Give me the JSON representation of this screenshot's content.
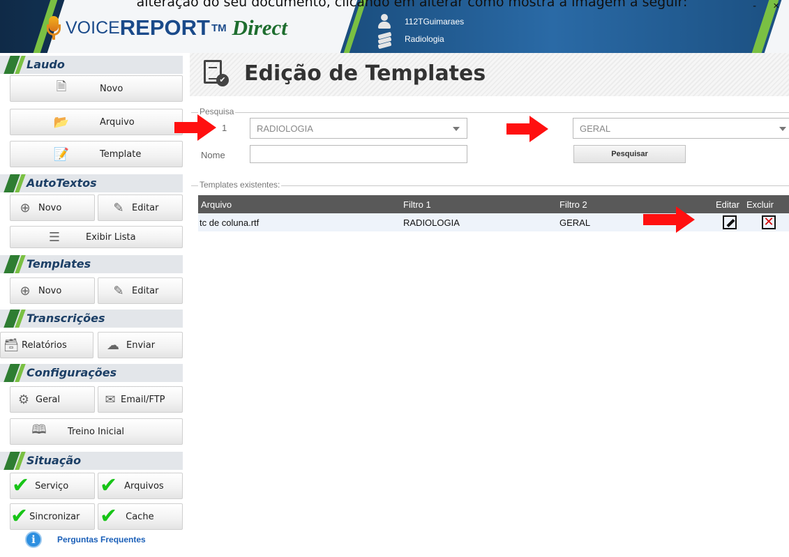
{
  "doc_caption": "alteração do seu documento, clicando em alterar como mostra a imagem a seguir:",
  "header": {
    "logo_voice": "VOICE",
    "logo_report": "REPORT",
    "logo_tm": "TM",
    "logo_direct": "Direct",
    "user_name": "112TGuimaraes",
    "user_department": "Radiologia",
    "window_controls": "- ×"
  },
  "sidebar": {
    "laudo": {
      "header": "Laudo",
      "novo": "Novo",
      "arquivo": "Arquivo",
      "template": "Template"
    },
    "autotextos": {
      "header": "AutoTextos",
      "novo": "Novo",
      "editar": "Editar",
      "exibir_lista": "Exibir Lista"
    },
    "templates": {
      "header": "Templates",
      "novo": "Novo",
      "editar": "Editar"
    },
    "transcricoes": {
      "header": "Transcrições",
      "relatorios": "Relatórios",
      "enviar": "Enviar"
    },
    "configuracoes": {
      "header": "Configurações",
      "geral": "Geral",
      "email_ftp": "Email/FTP",
      "treino_inicial": "Treino Inicial"
    },
    "situacao": {
      "header": "Situação",
      "servico": "Serviço",
      "arquivos": "Arquivos",
      "sincronizar": "Sincronizar",
      "cache": "Cache"
    },
    "faq": "Perguntas Frequentes"
  },
  "main": {
    "title": "Edição de Templates",
    "search": {
      "group_label": "Pesquisa",
      "filter1_label": "1",
      "filter1_value": "RADIOLOGIA",
      "filter2_value": "GERAL",
      "name_label": "Nome",
      "name_value": "",
      "search_button": "Pesquisar"
    },
    "templates": {
      "group_label": "Templates existentes:",
      "columns": [
        "Arquivo",
        "Filtro 1",
        "Filtro 2",
        "Editar",
        "Excluir"
      ],
      "rows": [
        {
          "arquivo": "tc de coluna.rtf",
          "filtro1": "RADIOLOGIA",
          "filtro2": "GERAL"
        }
      ]
    }
  },
  "colors": {
    "header_blue": "#1b4f80",
    "accent_green": "#7ac043",
    "arrow_red": "#ff1010",
    "check_green": "#17c417",
    "table_header": "#595959"
  }
}
